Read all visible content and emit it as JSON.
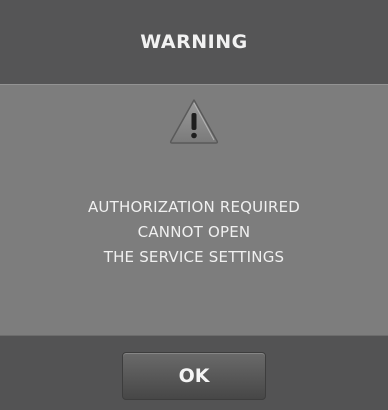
{
  "dialog": {
    "title": "WARNING",
    "icon": "warning-icon",
    "message_lines": [
      "AUTHORIZATION REQUIRED",
      "CANNOT OPEN",
      "THE SERVICE SETTINGS"
    ],
    "ok_label": "OK"
  },
  "colors": {
    "title_bar": "#555556",
    "body": "#7d7d7d",
    "footer": "#535354",
    "text": "#f0f0f0"
  }
}
